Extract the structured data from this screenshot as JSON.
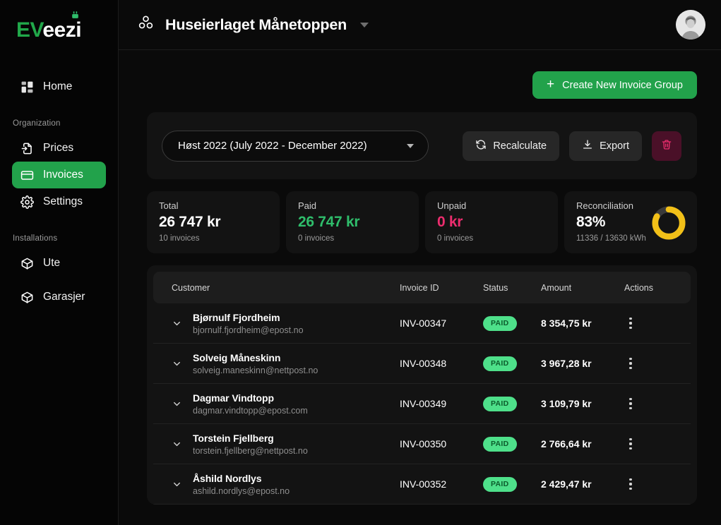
{
  "brand": {
    "logo_ev": "EV",
    "logo_eezi": "eezi",
    "plug_icon": "plug-icon",
    "green": "#22a24b"
  },
  "sidebar": {
    "home": {
      "label": "Home",
      "icon": "dashboard-grid-icon"
    },
    "sections": [
      {
        "title": "Organization",
        "items": [
          {
            "label": "Prices",
            "icon": "file-arrow-icon",
            "active": false
          },
          {
            "label": "Invoices",
            "icon": "credit-card-icon",
            "active": true
          },
          {
            "label": "Settings",
            "icon": "gear-icon",
            "active": false
          }
        ]
      },
      {
        "title": "Installations",
        "items": [
          {
            "label": "Ute",
            "icon": "cube-icon",
            "active": false
          },
          {
            "label": "Garasjer",
            "icon": "cube-icon",
            "active": false
          }
        ]
      }
    ]
  },
  "topbar": {
    "org_icon": "boxes-group-icon",
    "org_name": "Huseierlaget Månetoppen",
    "org_caret": "chevron-down-icon",
    "avatar": "user-avatar"
  },
  "actions": {
    "create_label": "Create New Invoice Group",
    "create_icon": "plus-icon"
  },
  "toolbar": {
    "period_value": "Høst 2022 (July 2022 - December 2022)",
    "period_caret": "chevron-down-icon",
    "recalculate_label": "Recalculate",
    "recalculate_icon": "refresh-icon",
    "export_label": "Export",
    "export_icon": "download-icon",
    "delete_icon": "trash-icon",
    "delete_color": "#ec2d6e"
  },
  "stats": [
    {
      "label": "Total",
      "value": "26 747 kr",
      "sub": "10 invoices",
      "color": "#ffffff"
    },
    {
      "label": "Paid",
      "value": "26 747 kr",
      "sub": "0 invoices",
      "color": "#2fbd6b"
    },
    {
      "label": "Unpaid",
      "value": "0 kr",
      "sub": "0 invoices",
      "color": "#ec2d6e"
    },
    {
      "label": "Reconciliation",
      "value": "83%",
      "sub": "11336 / 13630 kWh",
      "color": "#ffffff",
      "donut": {
        "percent": 83,
        "ring_color": "#f2c018",
        "track_color": "#3a3a3a"
      }
    }
  ],
  "table": {
    "columns": {
      "customer": "Customer",
      "invoice_id": "Invoice ID",
      "status": "Status",
      "amount": "Amount",
      "actions": "Actions"
    },
    "rows": [
      {
        "name": "Bjørnulf Fjordheim",
        "email": "bjornulf.fjordheim@epost.no",
        "invoice_id": "INV-00347",
        "status": "PAID",
        "amount": "8 354,75 kr"
      },
      {
        "name": "Solveig Måneskinn",
        "email": "solveig.maneskinn@nettpost.no",
        "invoice_id": "INV-00348",
        "status": "PAID",
        "amount": "3 967,28 kr"
      },
      {
        "name": "Dagmar Vindtopp",
        "email": "dagmar.vindtopp@epost.com",
        "invoice_id": "INV-00349",
        "status": "PAID",
        "amount": "3 109,79 kr"
      },
      {
        "name": "Torstein Fjellberg",
        "email": "torstein.fjellberg@nettpost.no",
        "invoice_id": "INV-00350",
        "status": "PAID",
        "amount": "2 766,64 kr"
      },
      {
        "name": "Åshild Nordlys",
        "email": "ashild.nordlys@epost.no",
        "invoice_id": "INV-00352",
        "status": "PAID",
        "amount": "2 429,47 kr"
      }
    ]
  }
}
